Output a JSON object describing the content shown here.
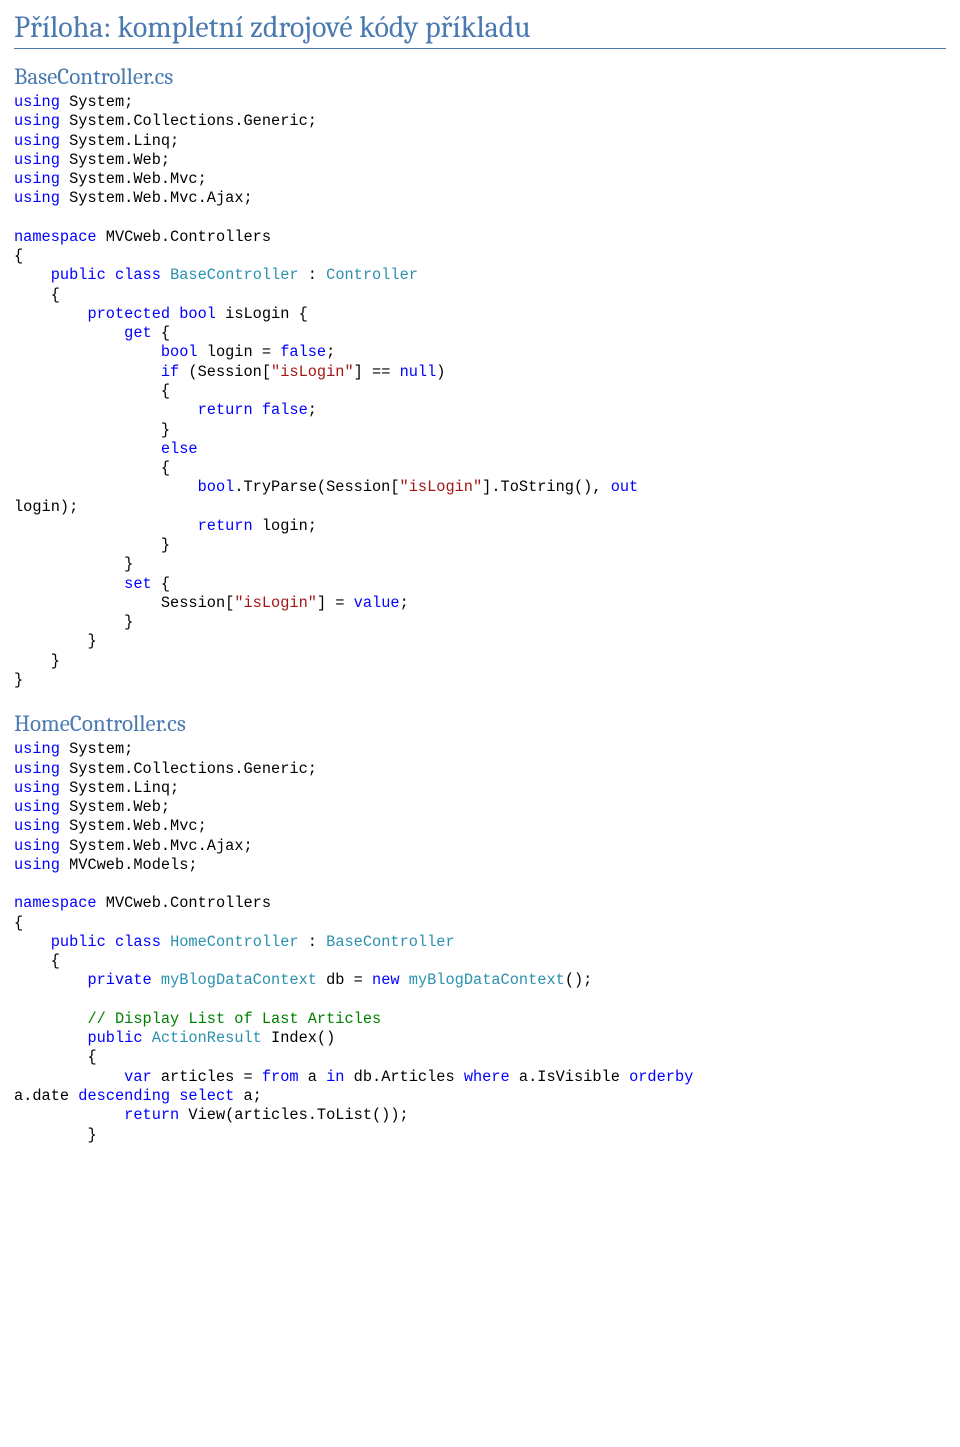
{
  "title": "Příloha: kompletní zdrojové kódy příkladu",
  "sections": [
    {
      "heading": "BaseController.cs",
      "code": [
        {
          "t": "kw",
          "v": "using"
        },
        {
          "t": "p",
          "v": " System;\n"
        },
        {
          "t": "kw",
          "v": "using"
        },
        {
          "t": "p",
          "v": " System.Collections.Generic;\n"
        },
        {
          "t": "kw",
          "v": "using"
        },
        {
          "t": "p",
          "v": " System.Linq;\n"
        },
        {
          "t": "kw",
          "v": "using"
        },
        {
          "t": "p",
          "v": " System.Web;\n"
        },
        {
          "t": "kw",
          "v": "using"
        },
        {
          "t": "p",
          "v": " System.Web.Mvc;\n"
        },
        {
          "t": "kw",
          "v": "using"
        },
        {
          "t": "p",
          "v": " System.Web.Mvc.Ajax;\n\n"
        },
        {
          "t": "kw",
          "v": "namespace"
        },
        {
          "t": "p",
          "v": " MVCweb.Controllers\n{\n    "
        },
        {
          "t": "kw",
          "v": "public"
        },
        {
          "t": "p",
          "v": " "
        },
        {
          "t": "kw",
          "v": "class"
        },
        {
          "t": "p",
          "v": " "
        },
        {
          "t": "type",
          "v": "BaseController"
        },
        {
          "t": "p",
          "v": " : "
        },
        {
          "t": "type",
          "v": "Controller"
        },
        {
          "t": "p",
          "v": "\n    {\n        "
        },
        {
          "t": "kw",
          "v": "protected"
        },
        {
          "t": "p",
          "v": " "
        },
        {
          "t": "kw",
          "v": "bool"
        },
        {
          "t": "p",
          "v": " isLogin {\n            "
        },
        {
          "t": "kw",
          "v": "get"
        },
        {
          "t": "p",
          "v": " {\n                "
        },
        {
          "t": "kw",
          "v": "bool"
        },
        {
          "t": "p",
          "v": " login = "
        },
        {
          "t": "kw",
          "v": "false"
        },
        {
          "t": "p",
          "v": ";\n                "
        },
        {
          "t": "kw",
          "v": "if"
        },
        {
          "t": "p",
          "v": " (Session["
        },
        {
          "t": "str",
          "v": "\"isLogin\""
        },
        {
          "t": "p",
          "v": "] == "
        },
        {
          "t": "kw",
          "v": "null"
        },
        {
          "t": "p",
          "v": ")\n                {\n                    "
        },
        {
          "t": "kw",
          "v": "return"
        },
        {
          "t": "p",
          "v": " "
        },
        {
          "t": "kw",
          "v": "false"
        },
        {
          "t": "p",
          "v": ";\n                }\n                "
        },
        {
          "t": "kw",
          "v": "else"
        },
        {
          "t": "p",
          "v": "\n                {\n                    "
        },
        {
          "t": "kw",
          "v": "bool"
        },
        {
          "t": "p",
          "v": ".TryParse(Session["
        },
        {
          "t": "str",
          "v": "\"isLogin\""
        },
        {
          "t": "p",
          "v": "].ToString(), "
        },
        {
          "t": "kw",
          "v": "out"
        },
        {
          "t": "p",
          "v": " \nlogin);\n                    "
        },
        {
          "t": "kw",
          "v": "return"
        },
        {
          "t": "p",
          "v": " login;\n                }\n            }\n            "
        },
        {
          "t": "kw",
          "v": "set"
        },
        {
          "t": "p",
          "v": " {\n                Session["
        },
        {
          "t": "str",
          "v": "\"isLogin\""
        },
        {
          "t": "p",
          "v": "] = "
        },
        {
          "t": "kw",
          "v": "value"
        },
        {
          "t": "p",
          "v": ";\n            }\n        }\n    }\n}"
        }
      ]
    },
    {
      "heading": "HomeController.cs",
      "code": [
        {
          "t": "kw",
          "v": "using"
        },
        {
          "t": "p",
          "v": " System;\n"
        },
        {
          "t": "kw",
          "v": "using"
        },
        {
          "t": "p",
          "v": " System.Collections.Generic;\n"
        },
        {
          "t": "kw",
          "v": "using"
        },
        {
          "t": "p",
          "v": " System.Linq;\n"
        },
        {
          "t": "kw",
          "v": "using"
        },
        {
          "t": "p",
          "v": " System.Web;\n"
        },
        {
          "t": "kw",
          "v": "using"
        },
        {
          "t": "p",
          "v": " System.Web.Mvc;\n"
        },
        {
          "t": "kw",
          "v": "using"
        },
        {
          "t": "p",
          "v": " System.Web.Mvc.Ajax;\n"
        },
        {
          "t": "kw",
          "v": "using"
        },
        {
          "t": "p",
          "v": " MVCweb.Models;\n\n"
        },
        {
          "t": "kw",
          "v": "namespace"
        },
        {
          "t": "p",
          "v": " MVCweb.Controllers\n{\n    "
        },
        {
          "t": "kw",
          "v": "public"
        },
        {
          "t": "p",
          "v": " "
        },
        {
          "t": "kw",
          "v": "class"
        },
        {
          "t": "p",
          "v": " "
        },
        {
          "t": "type",
          "v": "HomeController"
        },
        {
          "t": "p",
          "v": " : "
        },
        {
          "t": "type",
          "v": "BaseController"
        },
        {
          "t": "p",
          "v": "\n    {\n        "
        },
        {
          "t": "kw",
          "v": "private"
        },
        {
          "t": "p",
          "v": " "
        },
        {
          "t": "type",
          "v": "myBlogDataContext"
        },
        {
          "t": "p",
          "v": " db = "
        },
        {
          "t": "kw",
          "v": "new"
        },
        {
          "t": "p",
          "v": " "
        },
        {
          "t": "type",
          "v": "myBlogDataContext"
        },
        {
          "t": "p",
          "v": "();\n\n        "
        },
        {
          "t": "cmt",
          "v": "// Display List of Last Articles"
        },
        {
          "t": "p",
          "v": "\n        "
        },
        {
          "t": "kw",
          "v": "public"
        },
        {
          "t": "p",
          "v": " "
        },
        {
          "t": "type",
          "v": "ActionResult"
        },
        {
          "t": "p",
          "v": " Index()\n        {\n            "
        },
        {
          "t": "kw",
          "v": "var"
        },
        {
          "t": "p",
          "v": " articles = "
        },
        {
          "t": "kw",
          "v": "from"
        },
        {
          "t": "p",
          "v": " a "
        },
        {
          "t": "kw",
          "v": "in"
        },
        {
          "t": "p",
          "v": " db.Articles "
        },
        {
          "t": "kw",
          "v": "where"
        },
        {
          "t": "p",
          "v": " a.IsVisible "
        },
        {
          "t": "kw",
          "v": "orderby"
        },
        {
          "t": "p",
          "v": " \na.date "
        },
        {
          "t": "kw",
          "v": "descending"
        },
        {
          "t": "p",
          "v": " "
        },
        {
          "t": "kw",
          "v": "select"
        },
        {
          "t": "p",
          "v": " a;\n            "
        },
        {
          "t": "kw",
          "v": "return"
        },
        {
          "t": "p",
          "v": " View(articles.ToList());\n        }"
        }
      ]
    }
  ]
}
